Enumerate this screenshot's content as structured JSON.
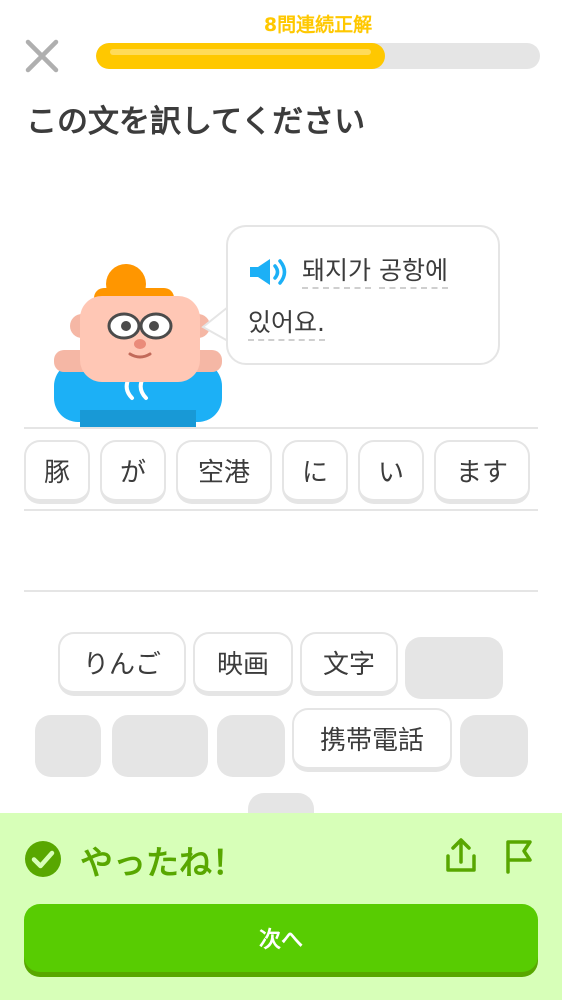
{
  "header": {
    "streak_label": "8問連続正解",
    "progress": 0.65,
    "close_icon": "close-icon"
  },
  "prompt": "この文を訳してください",
  "bubble": {
    "speaker_icon": "speaker-icon",
    "words": [
      "돼지가",
      "공항에",
      "있어요."
    ]
  },
  "answer_tiles": [
    "豚",
    "が",
    "空港",
    "に",
    "い",
    "ます"
  ],
  "word_bank": {
    "row1": [
      "りんご",
      "映画",
      "文字"
    ],
    "row2_visible": [
      "携帯電話"
    ]
  },
  "feedback": {
    "title": "やったね！",
    "check_icon": "check-circle-icon",
    "share_icon": "share-icon",
    "flag_icon": "flag-icon"
  },
  "next_button": "次へ",
  "colors": {
    "streak": "#ffc800",
    "success_bg": "#d7ffb8",
    "success_text": "#58a700",
    "button": "#58cc02"
  }
}
